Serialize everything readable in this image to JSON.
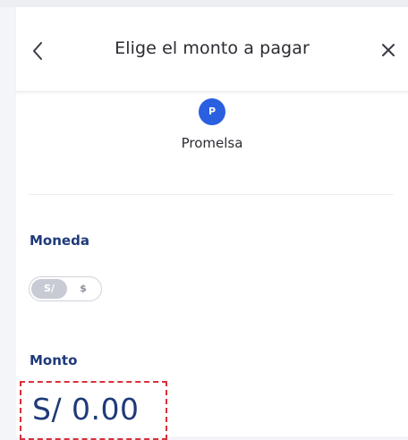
{
  "header": {
    "title": "Elige el monto a pagar",
    "back_icon": "chevron-left-icon",
    "close_icon": "close-icon"
  },
  "merchant": {
    "avatar_letter": "P",
    "name": "Promelsa"
  },
  "currency": {
    "label": "Moneda",
    "options": [
      "S/",
      "$"
    ],
    "selected": "S/"
  },
  "amount": {
    "label": "Monto",
    "value": "S/ 0.00"
  },
  "colors": {
    "accent": "#2a5fe0",
    "label_text": "#1f3a78",
    "highlight": "#d9303a"
  }
}
